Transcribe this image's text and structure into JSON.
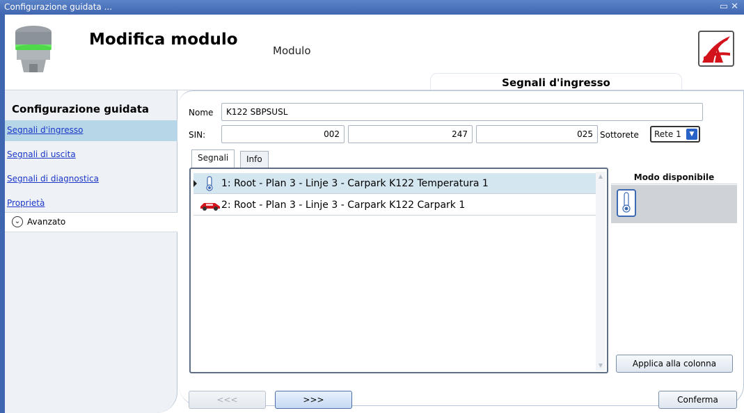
{
  "window": {
    "title": "Configurazione guidata ..."
  },
  "header": {
    "title": "Modifica modulo",
    "subtitle": "Modulo",
    "section": "Segnali d'ingresso"
  },
  "sidebar": {
    "title": "Configurazione guidata",
    "items": [
      {
        "label": "Segnali d'ingresso",
        "selected": true
      },
      {
        "label": "Segnali di uscita",
        "selected": false
      },
      {
        "label": "Segnali di diagnostica",
        "selected": false
      },
      {
        "label": "Proprietà",
        "selected": false
      }
    ],
    "advanced_label": "Avanzato"
  },
  "form": {
    "name_label": "Nome",
    "name_value": "K122 SBPSUSL",
    "sin_label": "SIN:",
    "sin_values": [
      "002",
      "247",
      "025"
    ],
    "subnet_label": "Sottorete",
    "subnet_value": "Rete 1"
  },
  "tabs": [
    {
      "label": "Segnali",
      "active": true
    },
    {
      "label": "Info",
      "active": false
    }
  ],
  "signals": [
    {
      "label": "1: Root - Plan 3 - Linje 3 - Carpark K122 Temperatura 1",
      "icon": "thermometer-icon",
      "selected": true
    },
    {
      "label": "2: Root - Plan 3 - Linje 3 - Carpark K122 Carpark 1",
      "icon": "car-icon",
      "selected": false
    }
  ],
  "mode_panel": {
    "title": "Modo disponibile",
    "icon": "thermometer-icon",
    "apply_label": "Applica alla colonna"
  },
  "footer": {
    "back_label": "<<<",
    "next_label": ">>>",
    "confirm_label": "Conferma"
  },
  "colors": {
    "titlebar": "#3f66b0",
    "sidebar_selected": "#b7d7e8",
    "link": "#1a36c8",
    "row_selected": "#d4e6ef"
  }
}
